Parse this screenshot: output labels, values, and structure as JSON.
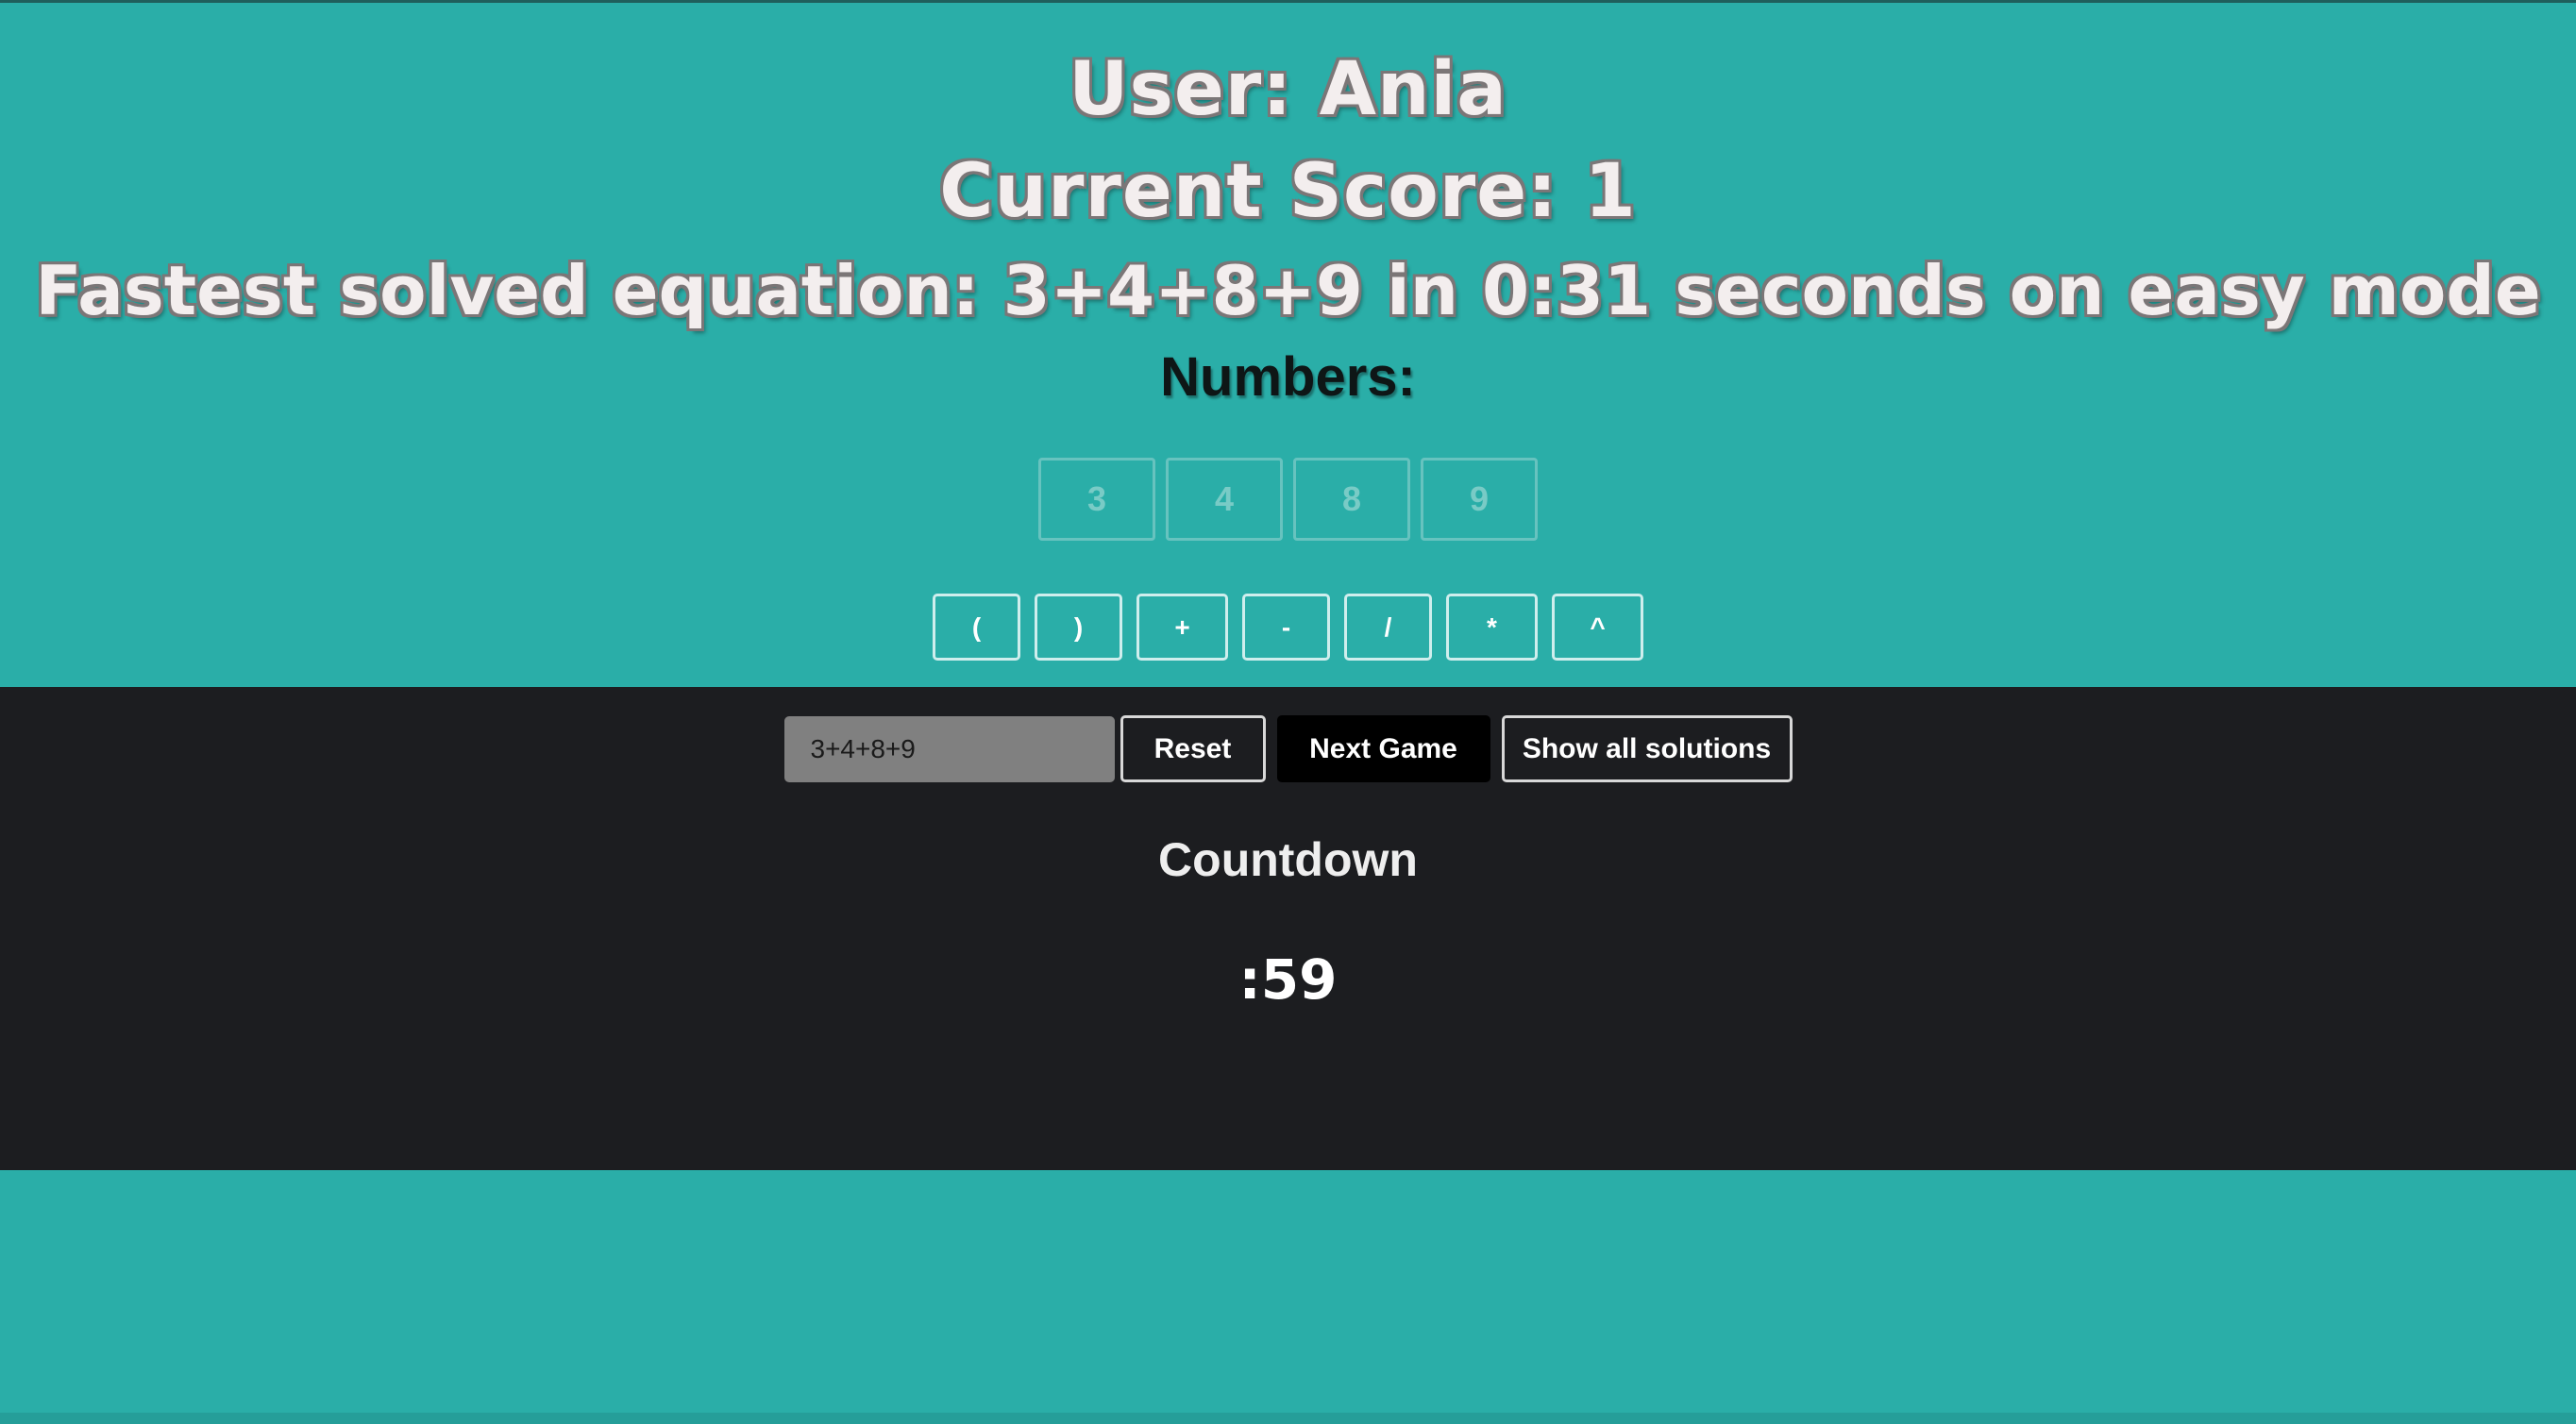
{
  "header": {
    "user_line": "User: Ania",
    "score_line": "Current Score: 1",
    "fastest_line": "Fastest solved equation: 3+4+8+9 in 0:31 seconds on easy mode"
  },
  "numbers": {
    "title": "Numbers:",
    "tiles": [
      "3",
      "4",
      "8",
      "9"
    ]
  },
  "operators": [
    "(",
    ")",
    "+",
    "-",
    "/",
    "*",
    "^"
  ],
  "controls": {
    "expression_value": "3+4+8+9",
    "reset_label": "Reset",
    "next_game_label": "Next Game",
    "show_solutions_label": "Show all solutions"
  },
  "countdown": {
    "label": "Countdown",
    "value": ":59"
  },
  "colors": {
    "background": "#2aaea8",
    "panel": "#1c1d20",
    "next_button": "#000000",
    "input": "#808080"
  }
}
